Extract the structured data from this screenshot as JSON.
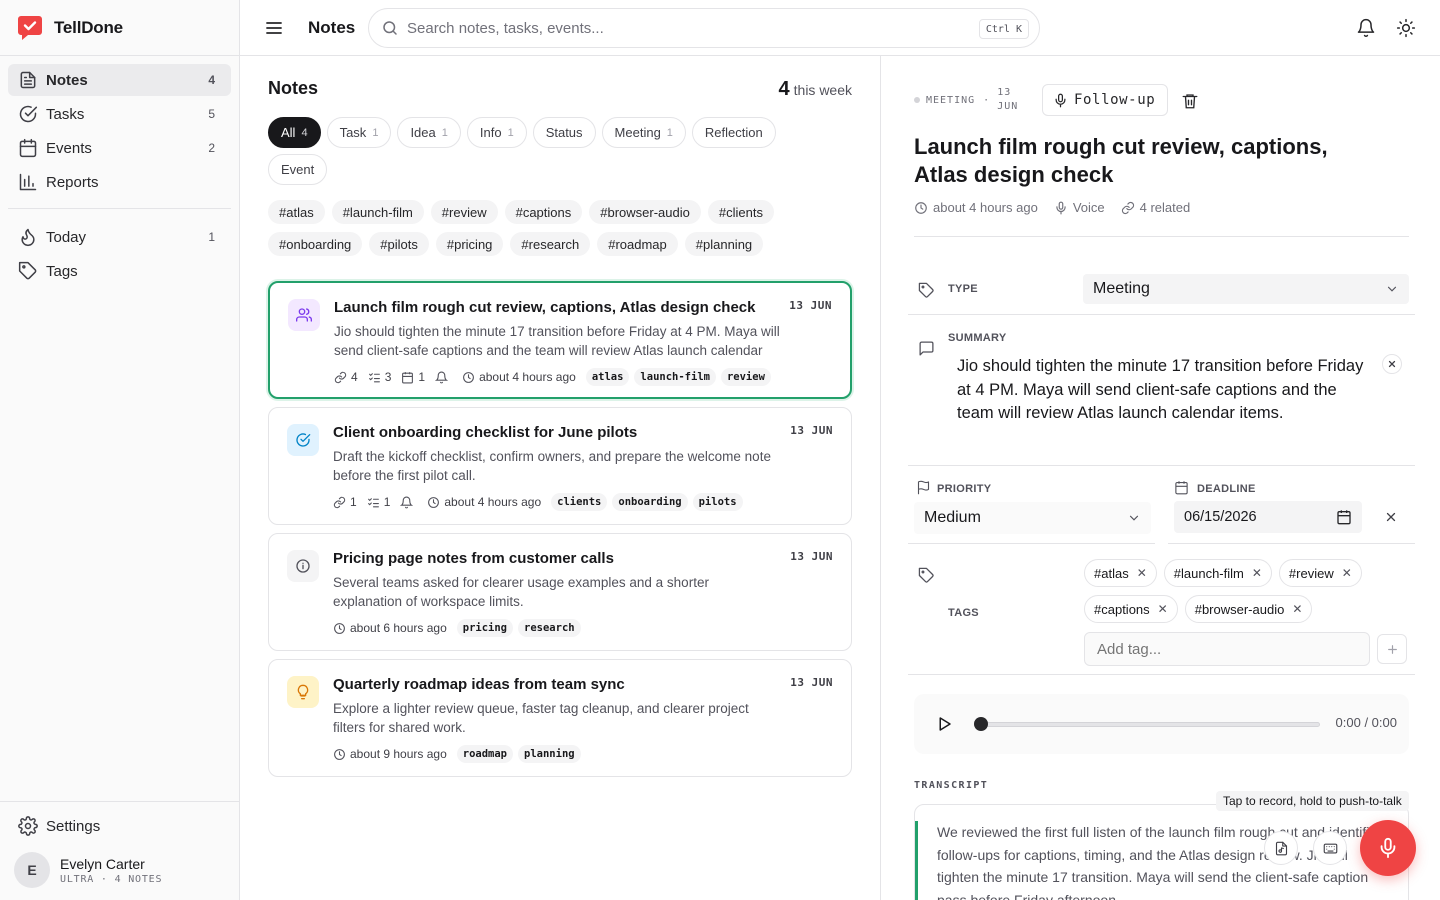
{
  "app": {
    "name": "TellDone",
    "accent": "#ef4444",
    "selected_border": "#22a06b"
  },
  "sidebar": {
    "items": [
      {
        "label": "Notes",
        "count": "4",
        "icon": "notes-icon",
        "active": true
      },
      {
        "label": "Tasks",
        "count": "5",
        "icon": "check-circle-icon"
      },
      {
        "label": "Events",
        "count": "2",
        "icon": "calendar-icon"
      },
      {
        "label": "Reports",
        "count": "",
        "icon": "bar-chart-icon"
      }
    ],
    "secondary": [
      {
        "label": "Today",
        "count": "1",
        "icon": "flame-icon"
      },
      {
        "label": "Tags",
        "count": "",
        "icon": "tags-icon"
      }
    ],
    "settings_label": "Settings",
    "user": {
      "initial": "E",
      "name": "Evelyn Carter",
      "plan": "ULTRA · 4 NOTES"
    }
  },
  "topbar": {
    "title": "Notes",
    "search_placeholder": "Search notes, tasks, events...",
    "shortcut": "Ctrl K"
  },
  "list": {
    "title": "Notes",
    "week_count": "4",
    "week_label": "this week",
    "filters": [
      {
        "label": "All",
        "count": "4",
        "active": true
      },
      {
        "label": "Task",
        "count": "1"
      },
      {
        "label": "Idea",
        "count": "1"
      },
      {
        "label": "Info",
        "count": "1"
      },
      {
        "label": "Status",
        "count": ""
      },
      {
        "label": "Meeting",
        "count": "1"
      },
      {
        "label": "Reflection",
        "count": ""
      },
      {
        "label": "Event",
        "count": ""
      }
    ],
    "tags": [
      "#atlas",
      "#launch-film",
      "#review",
      "#captions",
      "#browser-audio",
      "#clients",
      "#onboarding",
      "#pilots",
      "#pricing",
      "#research",
      "#roadmap",
      "#planning"
    ],
    "notes": [
      {
        "title": "Launch film rough cut review, captions, Atlas design check",
        "date": "13 JUN",
        "body": "Jio should tighten the minute 17 transition before Friday at 4 PM. Maya will send client-safe captions and the team will review Atlas launch calendar items.",
        "icon": "users-icon",
        "links": "4",
        "tasks": "3",
        "events": "1",
        "time": "about 4 hours ago",
        "tags": [
          "atlas",
          "launch-film",
          "review"
        ]
      },
      {
        "title": "Client onboarding checklist for June pilots",
        "date": "13 JUN",
        "body": "Draft the kickoff checklist, confirm owners, and prepare the welcome note before the first pilot call.",
        "icon": "check-badge-icon",
        "links": "1",
        "tasks": "1",
        "time": "about 4 hours ago",
        "tags": [
          "clients",
          "onboarding",
          "pilots"
        ]
      },
      {
        "title": "Pricing page notes from customer calls",
        "date": "13 JUN",
        "body": "Several teams asked for clearer usage examples and a shorter explanation of workspace limits.",
        "icon": "info-icon",
        "time": "about 6 hours ago",
        "tags": [
          "pricing",
          "research"
        ]
      },
      {
        "title": "Quarterly roadmap ideas from team sync",
        "date": "13 JUN",
        "body": "Explore a lighter review queue, faster tag cleanup, and clearer project filters for shared work.",
        "icon": "lightbulb-icon",
        "time": "about 9 hours ago",
        "tags": [
          "roadmap",
          "planning"
        ]
      }
    ]
  },
  "detail": {
    "type_badge": "MEETING",
    "date_badge": "13 JUN",
    "follow_up": "Follow-up",
    "title": "Launch film rough cut review, captions, Atlas design check",
    "time": "about 4 hours ago",
    "source": "Voice",
    "related": "4 related",
    "type_label": "TYPE",
    "type_value": "Meeting",
    "summary_label": "SUMMARY",
    "summary": "Jio should tighten the minute 17 transition before Friday at 4 PM. Maya will send client-safe captions and the team will review Atlas launch calendar items.",
    "priority_label": "PRIORITY",
    "priority_value": "Medium",
    "deadline_label": "DEADLINE",
    "deadline_value": "06/15/2026",
    "tags_label": "TAGS",
    "tags": [
      "#atlas",
      "#launch-film",
      "#review",
      "#captions",
      "#browser-audio"
    ],
    "add_tag_placeholder": "Add tag...",
    "audio_time": "0:00 / 0:00",
    "audio_progress": 0,
    "transcript_label": "TRANSCRIPT",
    "transcript": "We reviewed the first full listen of the launch film rough cut and identified follow-ups for captions, timing, and the Atlas design review. Jio will tighten the minute 17 transition. Maya will send the client-safe caption pass before Friday afternoon."
  },
  "recorder": {
    "tooltip": "Tap to record, hold to push-to-talk"
  }
}
